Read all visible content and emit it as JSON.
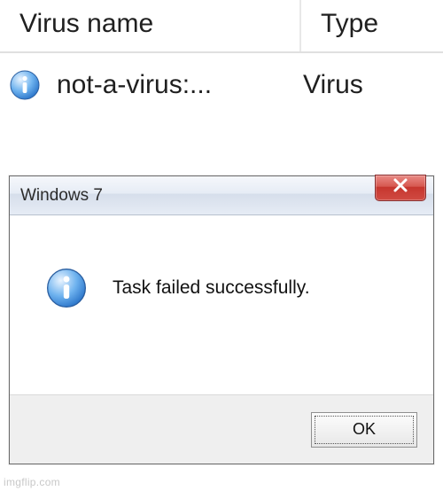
{
  "av": {
    "columns": {
      "name": "Virus name",
      "type": "Type"
    },
    "row": {
      "name": "not-a-virus:...",
      "type": "Virus"
    }
  },
  "dialog": {
    "title": "Windows 7",
    "message": "Task failed successfully.",
    "ok_label": "OK",
    "close_label": "×"
  },
  "watermark": "imgflip.com"
}
